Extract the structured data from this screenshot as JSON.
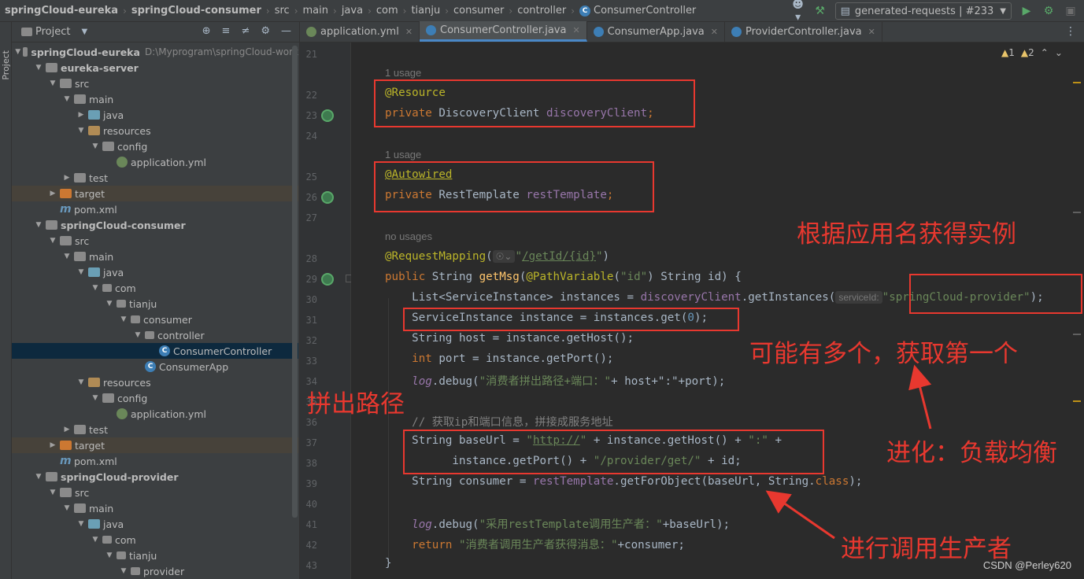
{
  "breadcrumbs": [
    "springCloud-eureka",
    "springCloud-consumer",
    "src",
    "main",
    "java",
    "com",
    "tianju",
    "consumer",
    "controller",
    "ConsumerController"
  ],
  "run_config": "generated-requests | #233",
  "project_panel": {
    "title": "Project",
    "tree": [
      {
        "label": "springCloud-eureka",
        "path": "D:\\Myprogram\\springCloud-work",
        "indent": 0,
        "chev": "v",
        "icon": "folder",
        "bold": true
      },
      {
        "label": "eureka-server",
        "indent": 1,
        "chev": "v",
        "icon": "folder",
        "bold": true
      },
      {
        "label": "src",
        "indent": 2,
        "chev": "v",
        "icon": "src"
      },
      {
        "label": "main",
        "indent": 3,
        "chev": "v",
        "icon": "folder"
      },
      {
        "label": "java",
        "indent": 4,
        "chev": ">",
        "icon": "java"
      },
      {
        "label": "resources",
        "indent": 4,
        "chev": "v",
        "icon": "res"
      },
      {
        "label": "config",
        "indent": 5,
        "chev": "v",
        "icon": "folder"
      },
      {
        "label": "application.yml",
        "indent": 6,
        "chev": "",
        "icon": "yml"
      },
      {
        "label": "test",
        "indent": 3,
        "chev": ">",
        "icon": "folder"
      },
      {
        "label": "target",
        "indent": 2,
        "chev": ">",
        "icon": "target",
        "hl": true
      },
      {
        "label": "pom.xml",
        "indent": 2,
        "chev": "",
        "icon": "pom"
      },
      {
        "label": "springCloud-consumer",
        "indent": 1,
        "chev": "v",
        "icon": "folder",
        "bold": true
      },
      {
        "label": "src",
        "indent": 2,
        "chev": "v",
        "icon": "src"
      },
      {
        "label": "main",
        "indent": 3,
        "chev": "v",
        "icon": "folder"
      },
      {
        "label": "java",
        "indent": 4,
        "chev": "v",
        "icon": "java"
      },
      {
        "label": "com",
        "indent": 5,
        "chev": "v",
        "icon": "pkg"
      },
      {
        "label": "tianju",
        "indent": 6,
        "chev": "v",
        "icon": "pkg"
      },
      {
        "label": "consumer",
        "indent": 7,
        "chev": "v",
        "icon": "pkg"
      },
      {
        "label": "controller",
        "indent": 8,
        "chev": "v",
        "icon": "pkg"
      },
      {
        "label": "ConsumerController",
        "indent": 9,
        "chev": "",
        "icon": "cls",
        "sel": true
      },
      {
        "label": "ConsumerApp",
        "indent": 8,
        "chev": "",
        "icon": "app"
      },
      {
        "label": "resources",
        "indent": 4,
        "chev": "v",
        "icon": "res"
      },
      {
        "label": "config",
        "indent": 5,
        "chev": "v",
        "icon": "folder"
      },
      {
        "label": "application.yml",
        "indent": 6,
        "chev": "",
        "icon": "yml"
      },
      {
        "label": "test",
        "indent": 3,
        "chev": ">",
        "icon": "folder"
      },
      {
        "label": "target",
        "indent": 2,
        "chev": ">",
        "icon": "target",
        "hl": true
      },
      {
        "label": "pom.xml",
        "indent": 2,
        "chev": "",
        "icon": "pom"
      },
      {
        "label": "springCloud-provider",
        "indent": 1,
        "chev": "v",
        "icon": "folder",
        "bold": true
      },
      {
        "label": "src",
        "indent": 2,
        "chev": "v",
        "icon": "src"
      },
      {
        "label": "main",
        "indent": 3,
        "chev": "v",
        "icon": "folder"
      },
      {
        "label": "java",
        "indent": 4,
        "chev": "v",
        "icon": "java"
      },
      {
        "label": "com",
        "indent": 5,
        "chev": "v",
        "icon": "pkg"
      },
      {
        "label": "tianju",
        "indent": 6,
        "chev": "v",
        "icon": "pkg"
      },
      {
        "label": "provider",
        "indent": 7,
        "chev": "v",
        "icon": "pkg"
      }
    ]
  },
  "tabs": [
    {
      "label": "application.yml",
      "icon": "yml",
      "active": false
    },
    {
      "label": "ConsumerController.java",
      "icon": "cls",
      "active": true
    },
    {
      "label": "ConsumerApp.java",
      "icon": "cls",
      "active": false
    },
    {
      "label": "ProviderController.java",
      "icon": "cls",
      "active": false
    }
  ],
  "inspection": {
    "warnings": "1",
    "weak_warnings": "2"
  },
  "usages": {
    "u1": "1 usage",
    "u2": "1 usage",
    "u3": "no usages"
  },
  "line_numbers": [
    "21",
    "22",
    "23",
    "24",
    "25",
    "26",
    "27",
    "28",
    "29",
    "30",
    "31",
    "32",
    "33",
    "34",
    "35",
    "36",
    "37",
    "38",
    "39",
    "40",
    "41",
    "42",
    "43"
  ],
  "code": {
    "l22": "@Resource",
    "l23_kw": "private ",
    "l23_type": "DiscoveryClient ",
    "l23_fld": "discoveryClient",
    "l23_end": ";",
    "l25": "@Autowired",
    "l26_kw": "private ",
    "l26_type": "RestTemplate ",
    "l26_fld": "restTemplate",
    "l26_end": ";",
    "l28_ann": "@RequestMapping",
    "l28_open": "(",
    "l28_str1": "\"",
    "l28_path": "/getId/{id}",
    "l28_str2": "\"",
    "l28_close": ")",
    "l29_kw": "public ",
    "l29_type": "String ",
    "l29_m": "getMsg",
    "l29_p1": "(",
    "l29_ann": "@PathVariable",
    "l29_p2": "(",
    "l29_s": "\"id\"",
    "l29_rest": ") String id) {",
    "l30_a": "List<ServiceInstance> instances = ",
    "l30_f": "discoveryClient",
    "l30_b": ".getInstances(",
    "l30_hint": "serviceId:",
    "l30_s": "\"springCloud-provider\"",
    "l30_e": ");",
    "l31_a": "ServiceInstance instance = instances.get(",
    "l31_n": "0",
    "l31_e": ");",
    "l32": "String host = instance.getHost();",
    "l33_kw": "int ",
    "l33_rest": "port = instance.getPort();",
    "l34_log": "log",
    "l34_a": ".debug(",
    "l34_s": "\"消费者拼出路径+端口：\"",
    "l34_e": "+ host+\":\"+port);",
    "l36": "// 获取ip和端口信息，拼接成服务地址",
    "l37_a": "String baseUrl = ",
    "l37_s1": "\"",
    "l37_url": "http://",
    "l37_s2": "\"",
    "l37_b": " + instance.getHost() + ",
    "l37_s3": "\":\"",
    "l37_c": " +",
    "l38_a": "instance.getPort() + ",
    "l38_s": "\"/provider/get/\"",
    "l38_e": " + id;",
    "l39_a": "String consumer = ",
    "l39_f": "restTemplate",
    "l39_b": ".getForObject(baseUrl, String.",
    "l39_kw": "class",
    "l39_e": ");",
    "l41_log": "log",
    "l41_a": ".debug(",
    "l41_s": "\"采用restTemplate调用生产者：\"",
    "l41_e": "+baseUrl);",
    "l42_kw": "return ",
    "l42_s": "\"消费者调用生产者获得消息：\"",
    "l42_e": "+consumer;",
    "l43": "}"
  },
  "callouts": {
    "by_app_name": "根据应用名获得实例",
    "maybe_multiple": "可能有多个，获取第一个",
    "build_path": "拼出路径",
    "evolve": "进化：负载均衡",
    "invoke_producer": "进行调用生产者"
  },
  "watermark": "CSDN @Perley620"
}
